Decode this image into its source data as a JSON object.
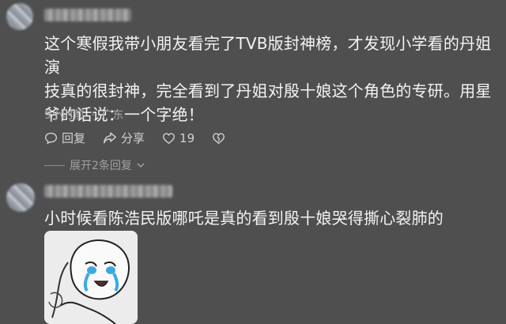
{
  "comments": [
    {
      "text_lines": [
        "这个寒假我带小朋友看完了TVB版封神榜，才发现小学看的丹姐演",
        "技真的很封神，完全看到了丹姐对殷十娘这个角色的专研。用星",
        "爷的话说：一个字绝！"
      ],
      "time": "9小时前",
      "separator": "·",
      "location": "广东",
      "actions": {
        "reply_label": "回复",
        "share_label": "分享",
        "like_count": "19"
      },
      "expand_label": "展开2条回复"
    },
    {
      "text": "小时候看陈浩民版哪吒是真的看到殷十娘哭得撕心裂肺的",
      "sticker_icon": "crying-cartoon-sticker"
    }
  ],
  "colors": {
    "background": "#4f4f4f",
    "text": "#f4f4f4",
    "meta": "#a9a9a9"
  }
}
